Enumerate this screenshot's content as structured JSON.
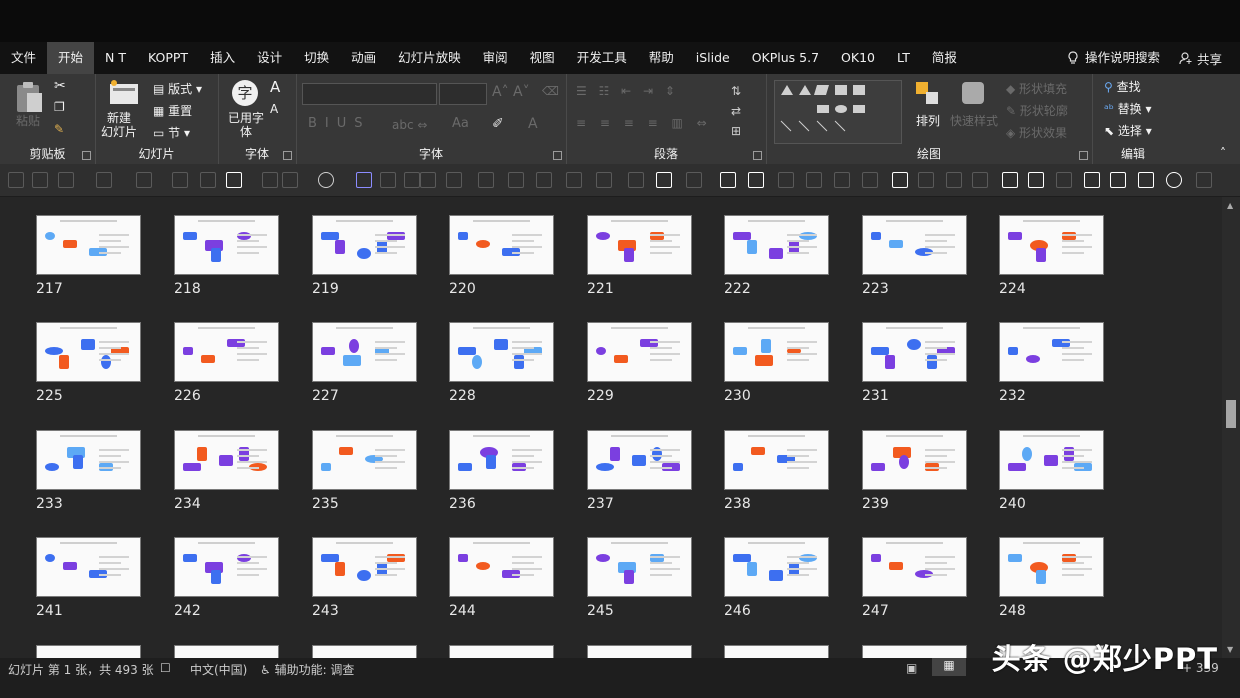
{
  "tabs": [
    "文件",
    "开始",
    "N T",
    "KOPPT",
    "插入",
    "设计",
    "切换",
    "动画",
    "幻灯片放映",
    "审阅",
    "视图",
    "开发工具",
    "帮助",
    "iSlide",
    "OKPlus 5.7",
    "OK10",
    "LT",
    "简报"
  ],
  "active_tab": "开始",
  "tell_me": "操作说明搜索",
  "share": "共享",
  "ribbon": {
    "clipboard": {
      "label": "剪贴板",
      "paste": "粘贴"
    },
    "slides": {
      "label": "幻灯片",
      "new_slide": "新建\n幻灯片",
      "layout": "版式",
      "reset": "重置",
      "section": "节"
    },
    "font_tool": {
      "label": "字体",
      "used_font": "已用字\n体"
    },
    "font": {
      "label": "字体"
    },
    "paragraph": {
      "label": "段落"
    },
    "drawing": {
      "label": "绘图",
      "arrange": "排列",
      "quick_styles": "快速样式",
      "fill": "形状填充",
      "outline": "形状轮廓",
      "effects": "形状效果"
    },
    "editing": {
      "label": "编辑",
      "find": "查找",
      "replace": "替换",
      "select": "选择"
    }
  },
  "slide_numbers": [
    "217",
    "218",
    "219",
    "220",
    "221",
    "222",
    "223",
    "224",
    "225",
    "226",
    "227",
    "228",
    "229",
    "230",
    "231",
    "232",
    "233",
    "234",
    "235",
    "236",
    "237",
    "238",
    "239",
    "240",
    "241",
    "242",
    "243",
    "244",
    "245",
    "246",
    "247",
    "248"
  ],
  "status": {
    "slide_info": "幻灯片 第 1 张，共 493 张",
    "language": "中文(中国)",
    "accessibility": "辅助功能: 调查",
    "zoom": "+ 339"
  },
  "watermark": "头条 @郑少PPT",
  "colors": {
    "blue": "#3d6ff0",
    "orange": "#f25a1f",
    "purple": "#7b3fe0",
    "light_blue": "#5da9f5",
    "cyan": "#23b4e8"
  }
}
